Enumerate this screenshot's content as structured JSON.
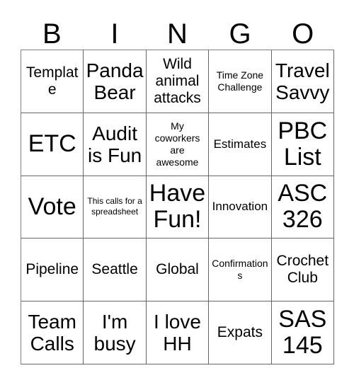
{
  "card": {
    "title": "BINGO Card",
    "header_letters": [
      "B",
      "I",
      "N",
      "G",
      "O"
    ],
    "columns": 5,
    "rows": 5,
    "colors": {
      "background": "#ffffff",
      "text": "#000000",
      "grid_line": "#666666"
    },
    "cells": [
      {
        "text": "Template",
        "size": "fs-md",
        "column": "B",
        "row": 1
      },
      {
        "text": "Panda Bear",
        "size": "fs-lg",
        "column": "I",
        "row": 1
      },
      {
        "text": "Wild animal attacks",
        "size": "fs-md",
        "column": "N",
        "row": 1
      },
      {
        "text": "Time Zone Challenge",
        "size": "fs-xs",
        "column": "G",
        "row": 1
      },
      {
        "text": "Travel Savvy",
        "size": "fs-lg",
        "column": "O",
        "row": 1
      },
      {
        "text": "ETC",
        "size": "fs-xl",
        "column": "B",
        "row": 2
      },
      {
        "text": "Audit is Fun",
        "size": "fs-lg",
        "column": "I",
        "row": 2
      },
      {
        "text": "My coworkers are awesome",
        "size": "fs-xs",
        "column": "N",
        "row": 2
      },
      {
        "text": "Estimates",
        "size": "fs-sm",
        "column": "G",
        "row": 2
      },
      {
        "text": "PBC List",
        "size": "fs-xl",
        "column": "O",
        "row": 2
      },
      {
        "text": "Vote",
        "size": "fs-xl",
        "column": "B",
        "row": 3
      },
      {
        "text": "This calls for a spreadsheet",
        "size": "fs-xxs",
        "column": "I",
        "row": 3
      },
      {
        "text": "Have Fun!",
        "size": "fs-xl",
        "column": "N",
        "row": 3
      },
      {
        "text": "Innovation",
        "size": "fs-sm",
        "column": "G",
        "row": 3
      },
      {
        "text": "ASC 326",
        "size": "fs-xl",
        "column": "O",
        "row": 3
      },
      {
        "text": "Pipeline",
        "size": "fs-md",
        "column": "B",
        "row": 4
      },
      {
        "text": "Seattle",
        "size": "fs-md",
        "column": "I",
        "row": 4
      },
      {
        "text": "Global",
        "size": "fs-md",
        "column": "N",
        "row": 4
      },
      {
        "text": "Confirmations",
        "size": "fs-xs",
        "column": "G",
        "row": 4
      },
      {
        "text": "Crochet Club",
        "size": "fs-md",
        "column": "O",
        "row": 4
      },
      {
        "text": "Team Calls",
        "size": "fs-lg",
        "column": "B",
        "row": 5
      },
      {
        "text": "I'm busy",
        "size": "fs-lg",
        "column": "I",
        "row": 5
      },
      {
        "text": "I love HH",
        "size": "fs-lg",
        "column": "N",
        "row": 5
      },
      {
        "text": "Expats",
        "size": "fs-md",
        "column": "G",
        "row": 5
      },
      {
        "text": "SAS 145",
        "size": "fs-xl",
        "column": "O",
        "row": 5
      }
    ]
  }
}
